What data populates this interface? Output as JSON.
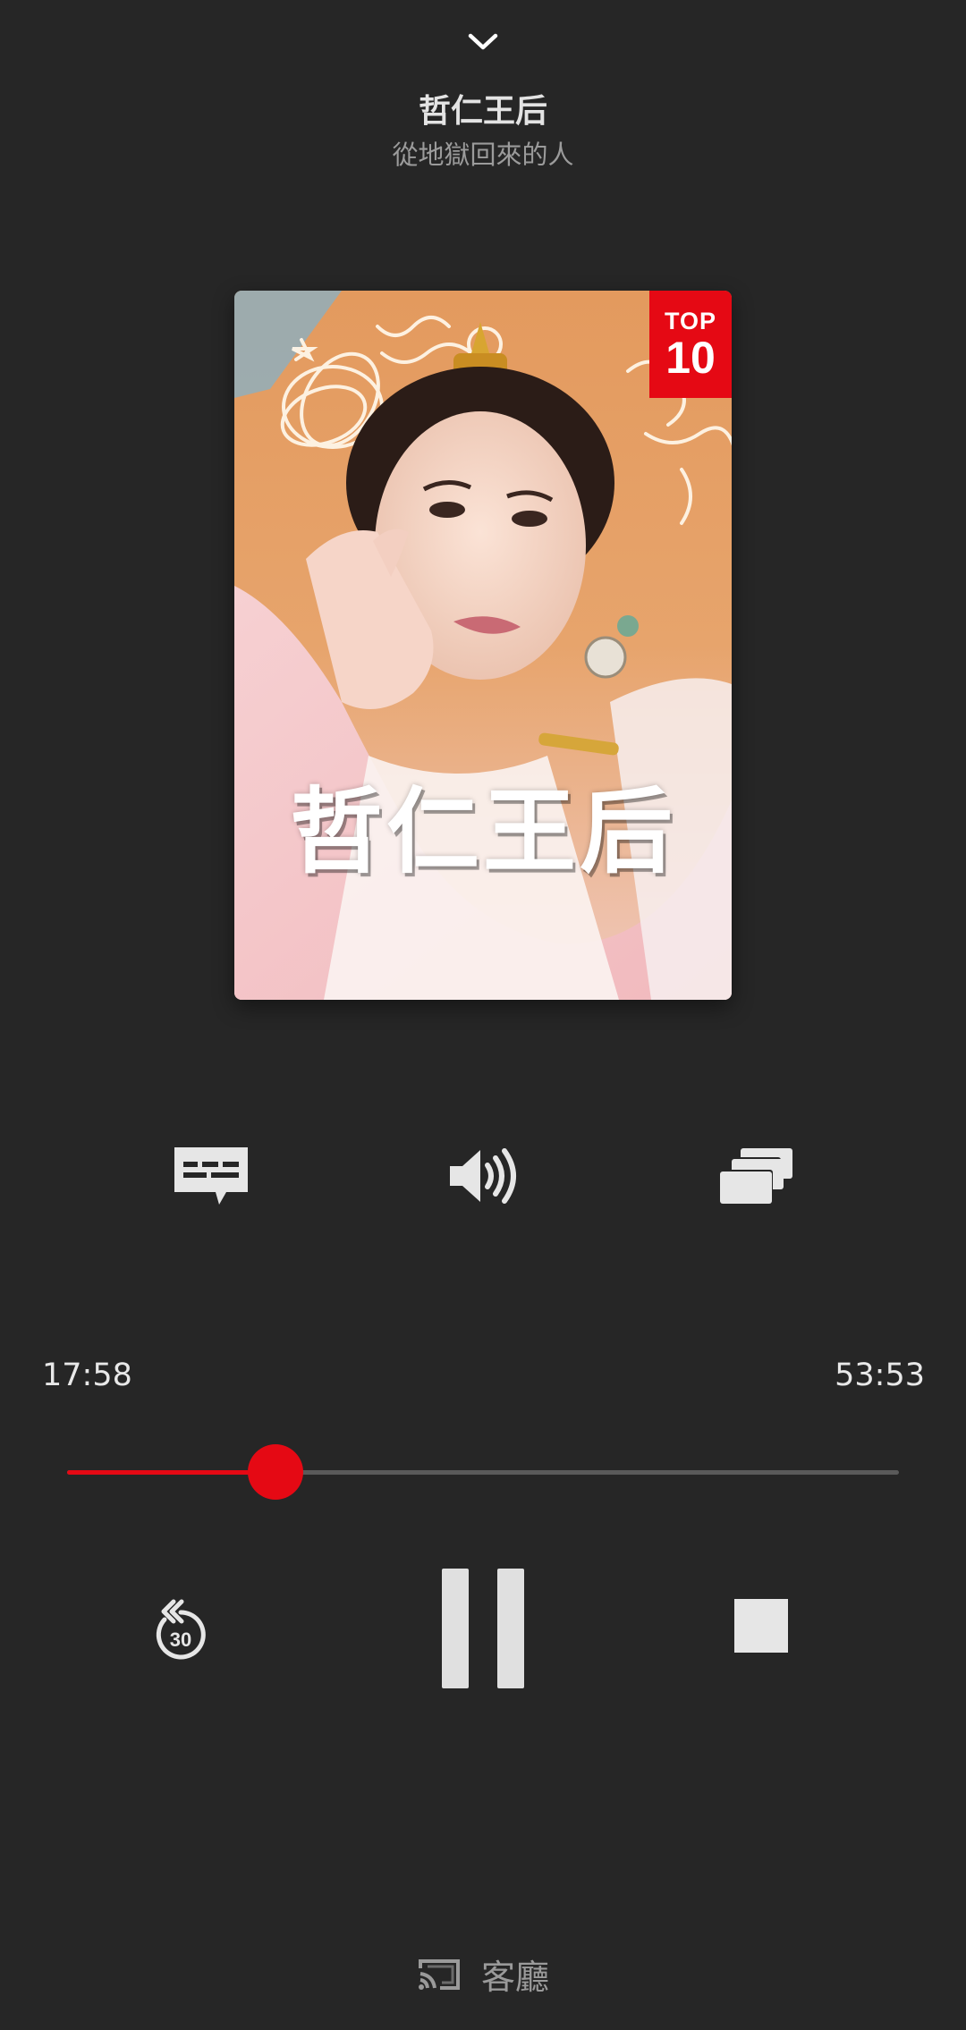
{
  "header": {
    "collapse_icon": "chevron-down-icon",
    "title": "哲仁王后",
    "subtitle": "從地獄回來的人"
  },
  "poster": {
    "title_text": "哲仁王后",
    "badge_line1": "TOP",
    "badge_line2": "10",
    "badge_color": "#e50914"
  },
  "options": {
    "subtitles_icon": "subtitles-icon",
    "audio_icon": "volume-icon",
    "episodes_icon": "episodes-icon"
  },
  "playback": {
    "elapsed": "17:58",
    "duration": "53:53",
    "progress_fraction": 0.25,
    "replay_label": "30",
    "replay_icon": "replay-30-icon",
    "pause_icon": "pause-icon",
    "stop_icon": "stop-icon",
    "accent_color": "#e50914"
  },
  "cast": {
    "icon": "cast-icon",
    "device_name": "客廳"
  }
}
